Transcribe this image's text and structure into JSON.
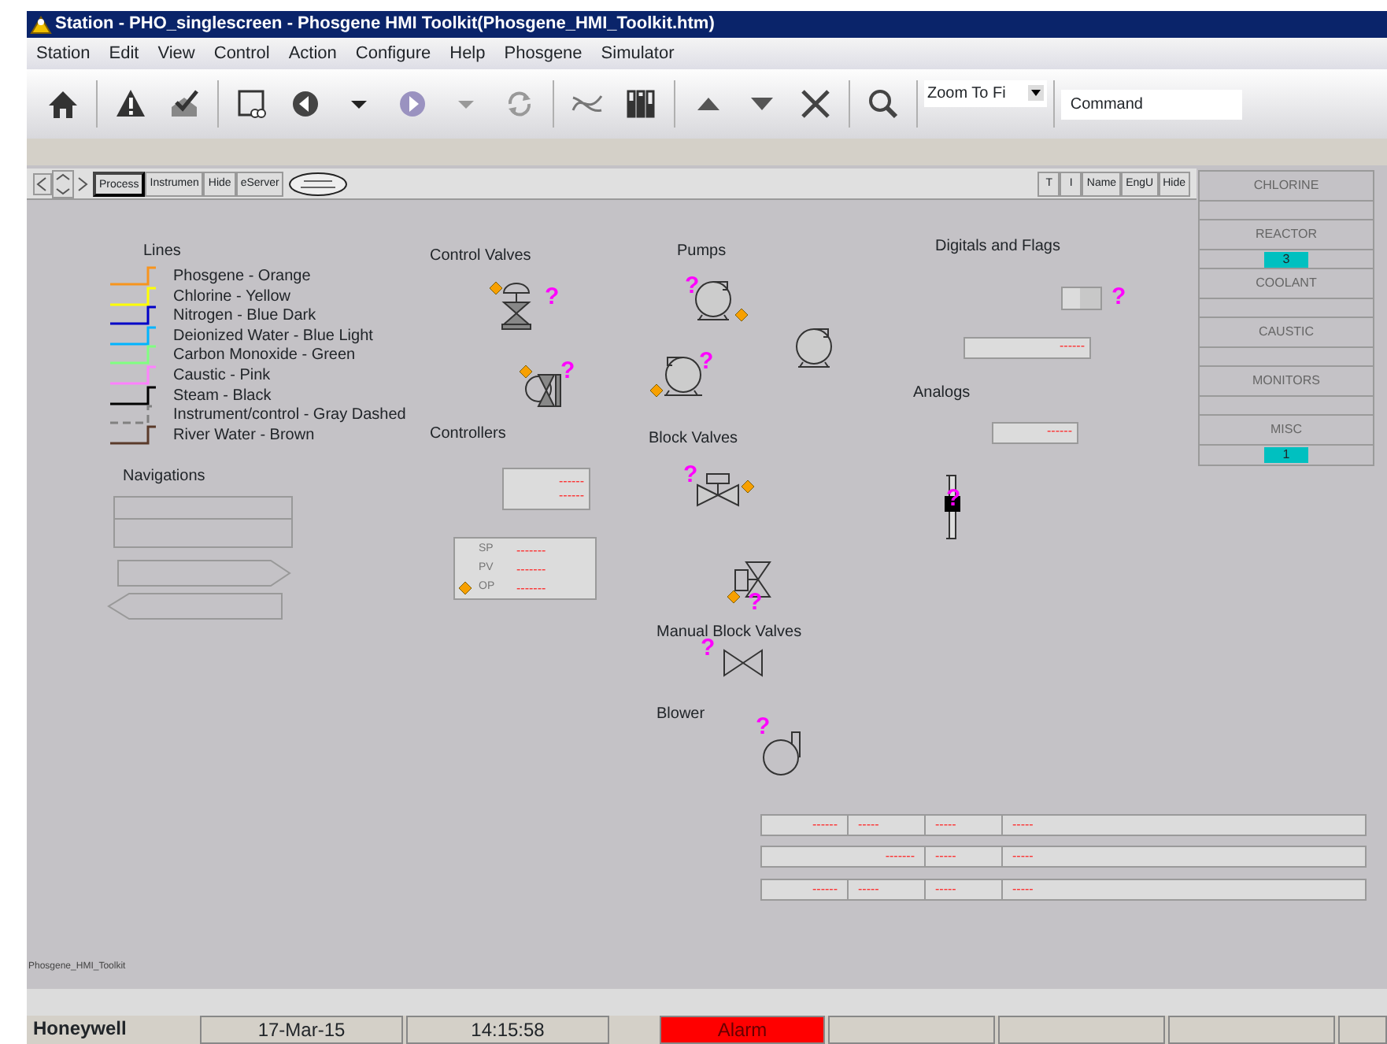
{
  "window": {
    "title": "Station - PHO_singlescreen - Phosgene HMI Toolkit(Phosgene_HMI_Toolkit.htm)"
  },
  "menu": [
    "Station",
    "Edit",
    "View",
    "Control",
    "Action",
    "Configure",
    "Help",
    "Phosgene",
    "Simulator"
  ],
  "toolbar": {
    "zoom": "Zoom To Fi",
    "command": "Command"
  },
  "display_toolbar": {
    "left_buttons": [
      {
        "label": "Process",
        "selected": true
      },
      {
        "label": "Instrumen",
        "selected": false
      },
      {
        "label": "Hide",
        "selected": false
      },
      {
        "label": "eServer",
        "selected": false
      }
    ],
    "right_buttons": [
      "T",
      "I",
      "Name",
      "EngU",
      "Hide"
    ]
  },
  "sections": [
    "Lines",
    "Control Valves",
    "Pumps",
    "Digitals and Flags",
    "Controllers",
    "Block Valves",
    "Analogs",
    "Navigations",
    "Manual Block Valves",
    "Blower"
  ],
  "lines_legend": [
    {
      "label": "Phosgene - Orange",
      "color": "#f7941d",
      "kind": "solid"
    },
    {
      "label": "Chlorine - Yellow",
      "color": "#ffff00",
      "kind": "solid"
    },
    {
      "label": "Nitrogen - Blue Dark",
      "color": "#0000c8",
      "kind": "solid"
    },
    {
      "label": "Deionized Water - Blue Light",
      "color": "#00b4ff",
      "kind": "solid"
    },
    {
      "label": "Carbon Monoxide - Green",
      "color": "#80ff80",
      "kind": "solid"
    },
    {
      "label": "Caustic - Pink",
      "color": "#ff80ff",
      "kind": "solid"
    },
    {
      "label": "Steam - Black",
      "color": "#000000",
      "kind": "solid"
    },
    {
      "label": "Instrument/control - Gray Dashed",
      "color": "#808080",
      "kind": "dashed"
    },
    {
      "label": "River Water - Brown",
      "color": "#5a3a2a",
      "kind": "solid"
    }
  ],
  "symbols": [
    {
      "kind": "control_valve",
      "badge": "?",
      "indicator": true
    },
    {
      "kind": "control_valve_side",
      "badge": "?",
      "indicator": true
    },
    {
      "kind": "pump",
      "badge": "?",
      "indicator": true
    },
    {
      "kind": "pump",
      "indicator": false
    },
    {
      "kind": "pump_left",
      "badge": "?",
      "indicator": true
    },
    {
      "kind": "block_valve",
      "badge": "?",
      "indicator": true
    },
    {
      "kind": "motor_valve",
      "badge": "?",
      "indicator": true
    },
    {
      "kind": "hand_valve",
      "badge": "?"
    },
    {
      "kind": "blower",
      "badge": "?"
    }
  ],
  "controllers": {
    "value_box": [
      "------",
      "------"
    ],
    "faceplate": [
      {
        "label": "SP",
        "value": "-------",
        "indicator": false
      },
      {
        "label": "PV",
        "value": "-------",
        "indicator": false
      },
      {
        "label": "OP",
        "value": "-------",
        "indicator": true
      }
    ]
  },
  "digitals": {
    "flag_badge": "?",
    "value": "------"
  },
  "analogs": {
    "value": "------",
    "bar_badge": "?"
  },
  "data_rows": [
    [
      "------",
      "-----",
      "-----",
      "-----"
    ],
    [
      "-------",
      "-----",
      "-----"
    ],
    [
      "------",
      "-----",
      "-----",
      "-----"
    ]
  ],
  "display_name": "Phosgene_HMI_Toolkit",
  "side_panel": [
    {
      "title": "CHLORINE"
    },
    {
      "title": "REACTOR",
      "value": "3"
    },
    {
      "title": "COOLANT"
    },
    {
      "title": "CAUSTIC"
    },
    {
      "title": "MONITORS"
    },
    {
      "title": "MISC",
      "value": "1"
    }
  ],
  "status_bar": {
    "brand": "Honeywell",
    "date": "17-Mar-15",
    "time": "14:15:58",
    "alarm": "Alarm"
  }
}
